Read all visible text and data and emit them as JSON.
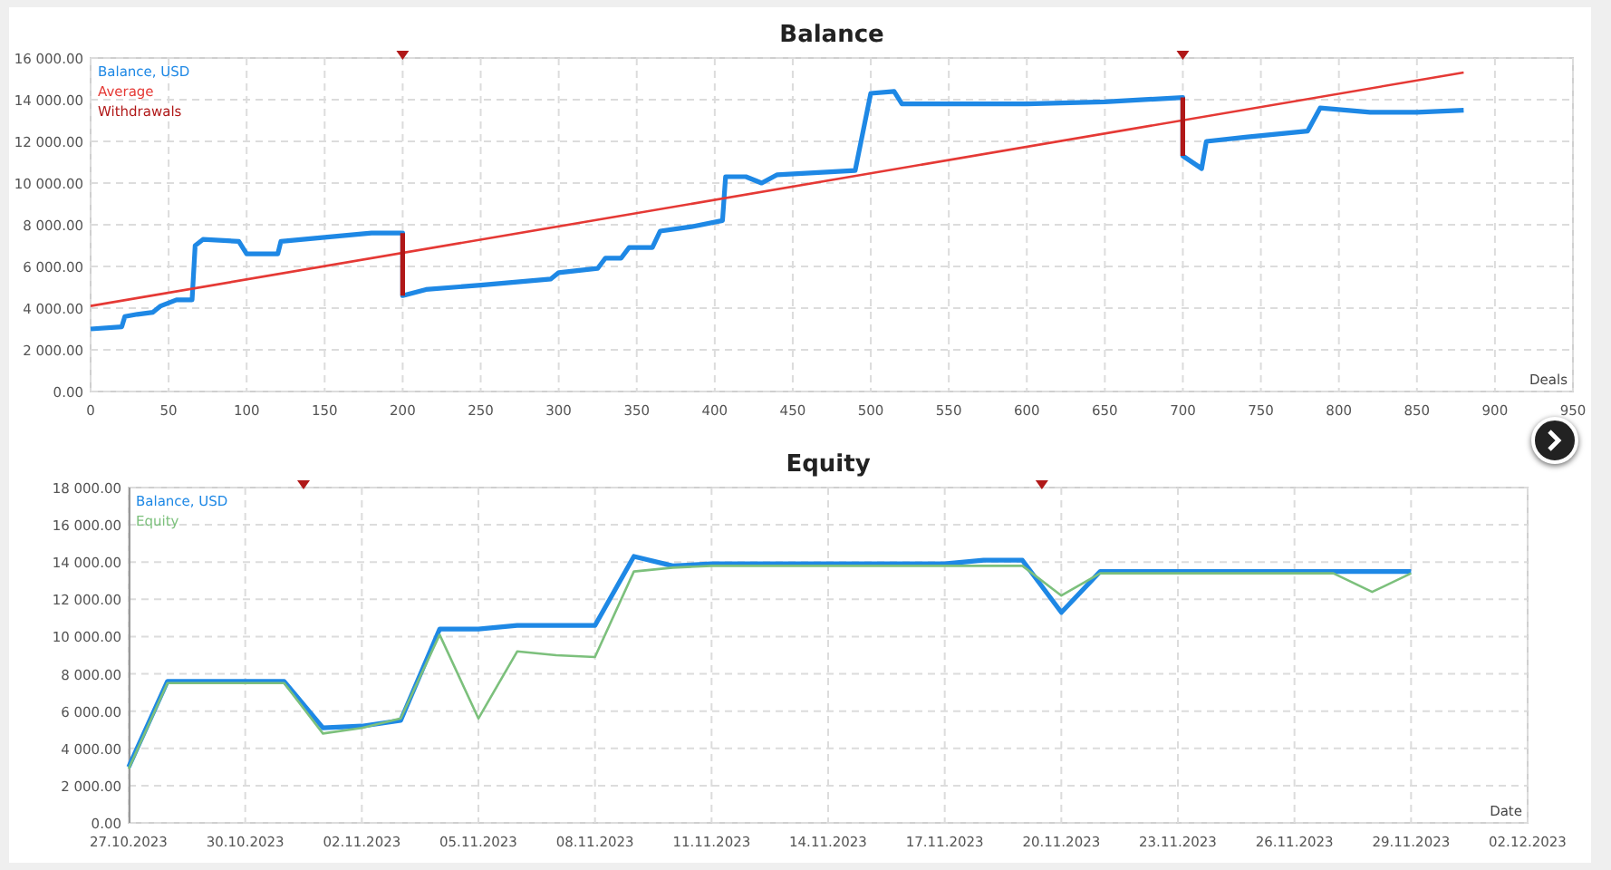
{
  "charts": [
    {
      "chart_data": {
        "type": "line",
        "title": "Balance",
        "xlabel": "Deals",
        "grid": true,
        "xlim": [
          0,
          950
        ],
        "ylim": [
          0,
          16000
        ],
        "xticks": [
          0,
          50,
          100,
          150,
          200,
          250,
          300,
          350,
          400,
          450,
          500,
          550,
          600,
          650,
          700,
          750,
          800,
          850,
          900,
          950
        ],
        "yticks": [
          {
            "value": 0,
            "label": "0.00"
          },
          {
            "value": 2000,
            "label": "2 000.00"
          },
          {
            "value": 4000,
            "label": "4 000.00"
          },
          {
            "value": 6000,
            "label": "6 000.00"
          },
          {
            "value": 8000,
            "label": "8 000.00"
          },
          {
            "value": 10000,
            "label": "10 000.00"
          },
          {
            "value": 12000,
            "label": "12 000.00"
          },
          {
            "value": 14000,
            "label": "14 000.00"
          },
          {
            "value": 16000,
            "label": "16 000.00"
          }
        ],
        "series": [
          {
            "name": "Balance, USD",
            "color": "#1e88e5",
            "x": [
              0,
              20,
              22,
              30,
              40,
              45,
              55,
              65,
              67,
              72,
              95,
              100,
              120,
              122,
              150,
              180,
              200,
              200,
              215,
              250,
              280,
              295,
              300,
              325,
              330,
              340,
              345,
              360,
              365,
              385,
              405,
              407,
              420,
              430,
              440,
              490,
              500,
              515,
              520,
              600,
              650,
              700,
              700,
              712,
              715,
              740,
              780,
              788,
              820,
              850,
              880
            ],
            "values": [
              3000,
              3100,
              3600,
              3700,
              3800,
              4100,
              4400,
              4400,
              7000,
              7300,
              7200,
              6600,
              6600,
              7200,
              7400,
              7600,
              7600,
              4600,
              4900,
              5100,
              5300,
              5400,
              5700,
              5900,
              6400,
              6400,
              6900,
              6900,
              7700,
              7900,
              8200,
              10300,
              10300,
              10000,
              10400,
              10600,
              14300,
              14400,
              13800,
              13800,
              13900,
              14100,
              11300,
              10700,
              12000,
              12200,
              12500,
              13600,
              13400,
              13400,
              13500
            ]
          },
          {
            "name": "Average",
            "color": "#e53935",
            "x": [
              0,
              880
            ],
            "values": [
              4100,
              15300
            ]
          },
          {
            "name": "Withdrawals",
            "color": "#b01818",
            "x": [
              200,
              200,
              null,
              700,
              700
            ],
            "values": [
              7600,
              4600,
              null,
              14100,
              11300
            ]
          }
        ]
      }
    },
    {
      "chart_data": {
        "type": "line",
        "title": "Equity",
        "xlabel": "Date",
        "grid": true,
        "ylim": [
          0,
          18000
        ],
        "categories": [
          "27.10.2023",
          null,
          null,
          "30.10.2023",
          null,
          null,
          "02.11.2023",
          null,
          null,
          "05.11.2023",
          null,
          null,
          "08.11.2023",
          null,
          null,
          "11.11.2023",
          null,
          null,
          "14.11.2023",
          null,
          null,
          "17.11.2023",
          null,
          null,
          "20.11.2023",
          null,
          null,
          "23.11.2023",
          null,
          null,
          "26.11.2023",
          null,
          null,
          "29.11.2023",
          null,
          null,
          "02.12.2023"
        ],
        "yticks": [
          {
            "value": 0,
            "label": "0.00"
          },
          {
            "value": 2000,
            "label": "2 000.00"
          },
          {
            "value": 4000,
            "label": "4 000.00"
          },
          {
            "value": 6000,
            "label": "6 000.00"
          },
          {
            "value": 8000,
            "label": "8 000.00"
          },
          {
            "value": 10000,
            "label": "10 000.00"
          },
          {
            "value": 12000,
            "label": "12 000.00"
          },
          {
            "value": 14000,
            "label": "14 000.00"
          },
          {
            "value": 16000,
            "label": "16 000.00"
          },
          {
            "value": 18000,
            "label": "18 000.00"
          }
        ],
        "series": [
          {
            "name": "Balance, USD",
            "color": "#1e88e5",
            "values": [
              3000,
              7600,
              7600,
              7600,
              7600,
              5100,
              5200,
              5500,
              10400,
              10400,
              10600,
              10600,
              10600,
              14300,
              13800,
              13900,
              13900,
              13900,
              13900,
              13900,
              13900,
              13900,
              14100,
              14100,
              11300,
              13500,
              13500,
              13500,
              13500,
              13500,
              13500,
              13500,
              13500,
              13500,
              null,
              null,
              null
            ]
          },
          {
            "name": "Equity",
            "color": "#7cc07c",
            "values": [
              2900,
              7500,
              7500,
              7500,
              7500,
              4800,
              5100,
              5600,
              10100,
              5600,
              9200,
              9000,
              8900,
              13500,
              13700,
              13800,
              13800,
              13800,
              13800,
              13800,
              13800,
              13800,
              13800,
              13800,
              12200,
              13400,
              13400,
              13400,
              13400,
              13400,
              13400,
              13400,
              12400,
              13400,
              null,
              null,
              null
            ]
          }
        ]
      }
    }
  ]
}
